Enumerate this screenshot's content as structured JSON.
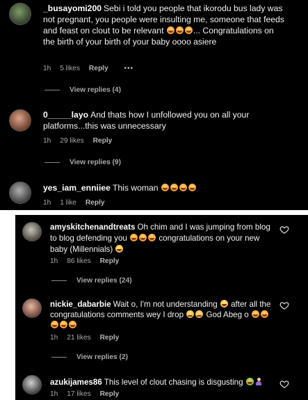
{
  "comments_top": [
    {
      "username": "_busayomi200",
      "segments": [
        {
          "t": "Sebi i told you people that ikorodu bus lady was not pregnant, you people were insulting me, someone that feeds and feast on clout to be relevant "
        },
        {
          "e": "smile"
        },
        {
          "e": "smile"
        },
        {
          "e": "smile"
        },
        {
          "t": "... Congratulations on the birth of your birth of your baby oooo asiere"
        }
      ],
      "time": "1h",
      "likes": "5 likes",
      "reply": "Reply",
      "more": "•••",
      "view_replies": "View replies (4)"
    },
    {
      "username": "0_____layo",
      "segments": [
        {
          "t": "And thats how I unfollowed you on all your platforms...this was unnecessary"
        }
      ],
      "time": "1h",
      "likes": "29 likes",
      "reply": "Reply",
      "view_replies": "View replies (9)"
    },
    {
      "username": "yes_iam_enniiee",
      "segments": [
        {
          "t": "This woman "
        },
        {
          "e": "smile"
        },
        {
          "e": "smile"
        },
        {
          "e": "smile"
        },
        {
          "e": "smile"
        }
      ],
      "time": "1h",
      "likes": "1 like",
      "reply": "Reply"
    }
  ],
  "comments_bottom": [
    {
      "username": "amyskitchenandtreats",
      "segments": [
        {
          "t": "Oh chim and I was jumping from blog to blog defending you "
        },
        {
          "e": "smile"
        },
        {
          "e": "smile"
        },
        {
          "e": "smile"
        },
        {
          "t": " congratulations on your new baby (Millennials) "
        },
        {
          "e": "wink"
        }
      ],
      "time": "1h",
      "likes": "86 likes",
      "reply": "Reply",
      "view_replies": "View replies (24)"
    },
    {
      "username": "nickie_dabarbie",
      "segments": [
        {
          "t": "Wait o, I'm not understanding "
        },
        {
          "e": "wink"
        },
        {
          "t": " after all the congratulations comments wey I drop "
        },
        {
          "e": "sad"
        },
        {
          "e": "sad"
        },
        {
          "t": " God Abeg o "
        },
        {
          "e": "smile"
        },
        {
          "e": "smile"
        },
        {
          "e": "smile"
        },
        {
          "e": "smile"
        },
        {
          "e": "smile"
        }
      ],
      "time": "1h",
      "likes": "21 likes",
      "reply": "Reply",
      "view_replies": "View replies (2)"
    },
    {
      "username": "azukijames86",
      "segments": [
        {
          "t": "This level of clout chasing is disgusting "
        },
        {
          "e": "vomit"
        },
        {
          "e": "person"
        }
      ],
      "time": "1h",
      "likes": "17 likes",
      "reply": "Reply"
    }
  ]
}
